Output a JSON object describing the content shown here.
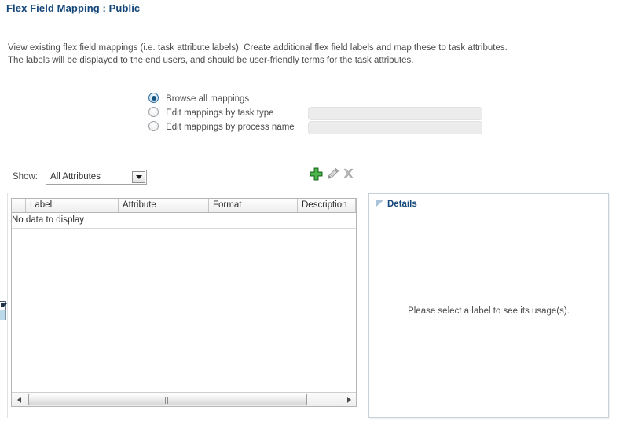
{
  "page": {
    "title": "Flex Field Mapping : Public",
    "description_lines": [
      "View existing flex field mappings (i.e. task attribute labels). Create additional flex field labels and map these to task attributes.",
      "The labels will be displayed to the end users, and should be user-friendly terms for the task attributes."
    ]
  },
  "mode_options": [
    {
      "label": "Browse all mappings",
      "selected": true,
      "has_input": false,
      "input_value": ""
    },
    {
      "label": "Edit mappings by task type",
      "selected": false,
      "has_input": true,
      "input_value": ""
    },
    {
      "label": "Edit mappings by process name",
      "selected": false,
      "has_input": true,
      "input_value": ""
    }
  ],
  "toolbar": {
    "show_label": "Show:",
    "show_selected": "All Attributes",
    "show_options": [
      "All Attributes"
    ],
    "actions": [
      {
        "name": "add",
        "icon": "plus-icon",
        "enabled": true
      },
      {
        "name": "edit",
        "icon": "pencil-icon",
        "enabled": false
      },
      {
        "name": "delete",
        "icon": "close-x-icon",
        "enabled": false
      }
    ]
  },
  "table": {
    "columns": [
      "Label",
      "Attribute",
      "Format",
      "Description"
    ],
    "rows": [],
    "empty_message": "No data to display"
  },
  "details": {
    "title": "Details",
    "empty_message": "Please select a label to see its usage(s)."
  },
  "colors": {
    "title_blue": "#16477a",
    "body_text": "#4c4c4c",
    "add_green": "#3aa13a",
    "disabled_gray": "#a9a9a9",
    "panel_border": "#c8d0d8"
  }
}
